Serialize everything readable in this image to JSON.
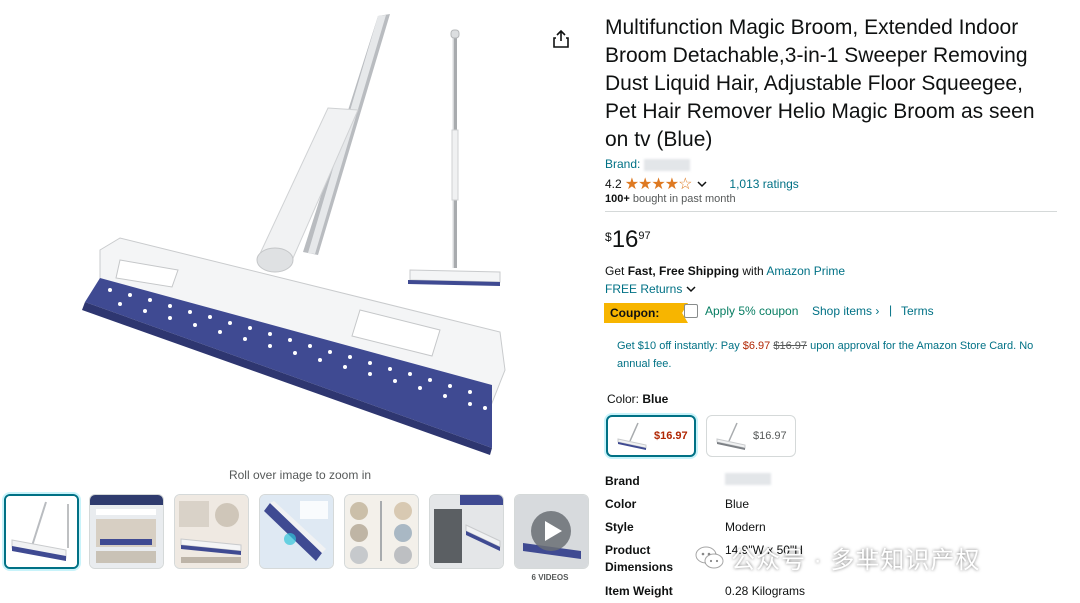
{
  "product": {
    "title": "Multifunction Magic Broom, Extended Indoor Broom Detachable,3-in-1 Sweeper Removing Dust Liquid Hair, Adjustable Floor Squeegee, Pet Hair Remover Helio Magic Broom as seen on tv (Blue)",
    "brand_label": "Brand:",
    "rating": "4.2",
    "rating_value": 4.2,
    "ratings_count": "1,013 ratings",
    "bought_bold": "100+",
    "bought_rest": " bought in past month"
  },
  "price": {
    "symbol": "$",
    "whole": "16",
    "fraction": "97"
  },
  "shipping": {
    "prefix": "Get ",
    "bold": "Fast, Free Shipping",
    "mid": " with ",
    "prime": "Amazon Prime",
    "returns": "FREE Returns"
  },
  "coupon": {
    "badge": "Coupon:",
    "apply": "Apply 5% coupon",
    "shop_items": "Shop items ›",
    "pipe": "|",
    "terms": "Terms"
  },
  "card_offer": {
    "pre": "Get $10 off instantly: Pay ",
    "new_price": "$6.97",
    "old_price": "$16.97",
    "post": " upon approval for the Amazon Store Card. No annual fee."
  },
  "color": {
    "label": "Color: ",
    "selected": "Blue",
    "swatches": [
      {
        "price": "$16.97",
        "selected": true
      },
      {
        "price": "$16.97",
        "selected": false
      }
    ]
  },
  "specs": [
    {
      "key": "Brand",
      "value": ""
    },
    {
      "key": "Color",
      "value": "Blue"
    },
    {
      "key": "Style",
      "value": "Modern"
    },
    {
      "key": "Product Dimensions",
      "value": "14.9\"W x 50\"H"
    },
    {
      "key": "Item Weight",
      "value": "0.28 Kilograms"
    }
  ],
  "gallery": {
    "zoom_hint": "Roll over image to zoom in",
    "videos_label": "6 VIDEOS",
    "thumb_count": 7
  },
  "watermark": {
    "text": "公众号 · 多芈知识产权"
  },
  "colors": {
    "link": "#007185",
    "star": "#de7921",
    "coupon": "#f7b500",
    "price_red": "#b12704",
    "broom_blue": "#3f4a92"
  }
}
